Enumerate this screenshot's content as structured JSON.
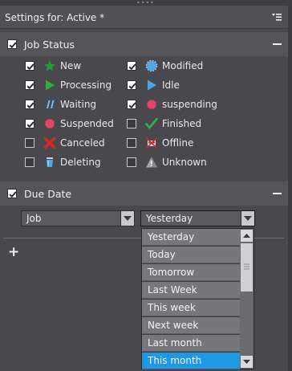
{
  "panel": {
    "title": "Settings for: Active *"
  },
  "job_status": {
    "label": "Job Status",
    "checked": true,
    "items": [
      {
        "label": "New",
        "checked": true,
        "icon": "star-icon",
        "color": "#1e9e3a"
      },
      {
        "label": "Modified",
        "checked": true,
        "icon": "circle-dashed-icon",
        "color": "#4fa8e8"
      },
      {
        "label": "Processing",
        "checked": true,
        "icon": "play-icon",
        "color": "#2fae3c"
      },
      {
        "label": "Idle",
        "checked": true,
        "icon": "play-icon",
        "color": "#4aa6e6"
      },
      {
        "label": "Waiting",
        "checked": true,
        "icon": "pause-icon",
        "color": "#6fc0f0"
      },
      {
        "label": "suspending",
        "checked": true,
        "icon": "octagon-icon",
        "color": "#e8416a"
      },
      {
        "label": "Suspended",
        "checked": true,
        "icon": "octagon-icon",
        "color": "#e8416a"
      },
      {
        "label": "Finished",
        "checked": false,
        "icon": "checkmark-icon",
        "color": "#2fb24a"
      },
      {
        "label": "Canceled",
        "checked": false,
        "icon": "x-icon",
        "color": "#e02424"
      },
      {
        "label": "Offline",
        "checked": false,
        "icon": "offline-icon",
        "color": "#c03030"
      },
      {
        "label": "Deleting",
        "checked": false,
        "icon": "trash-icon",
        "color": "#4aa6e6"
      },
      {
        "label": "Unknown",
        "checked": false,
        "icon": "warning-icon",
        "color": "#a8a8a8"
      }
    ]
  },
  "due_date": {
    "label": "Due Date",
    "checked": true,
    "field": "Job",
    "value": "Yesterday",
    "options": [
      "Yesterday",
      "Today",
      "Tomorrow",
      "Last Week",
      "This week",
      "Next week",
      "Last month",
      "This month"
    ],
    "selected_option": "This month"
  },
  "colors": {
    "selection": "#1f98e4",
    "panel_bg": "#49494d"
  }
}
